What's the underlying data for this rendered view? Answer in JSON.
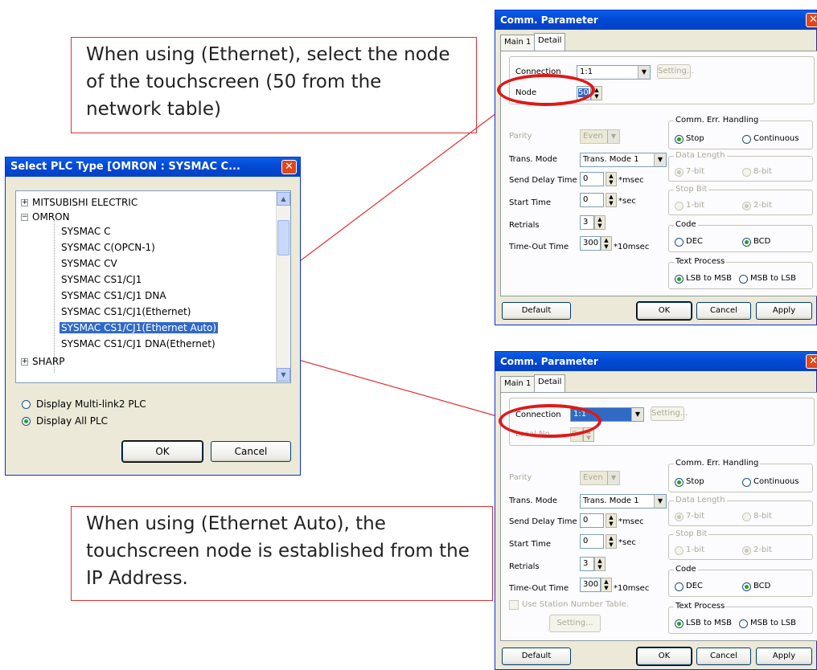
{
  "callouts": {
    "ethernet": "When using (Ethernet), select the node of the touchscreen (50 from the network table)",
    "ethernet_auto": "When using (Ethernet Auto), the touchscreen node is established from the IP Address."
  },
  "plc_dialog": {
    "title": "Select PLC Type [OMRON : SYSMAC C...",
    "tree": [
      {
        "label": "MITSUBISHI ELECTRIC",
        "expander": "+"
      },
      {
        "label": "OMRON",
        "expander": "-"
      },
      {
        "label": "SYSMAC C"
      },
      {
        "label": "SYSMAC C(OPCN-1)"
      },
      {
        "label": "SYSMAC CV"
      },
      {
        "label": "SYSMAC CS1/CJ1"
      },
      {
        "label": "SYSMAC CS1/CJ1 DNA"
      },
      {
        "label": "SYSMAC CS1/CJ1(Ethernet)"
      },
      {
        "label": "SYSMAC CS1/CJ1(Ethernet Auto)",
        "selected": true
      },
      {
        "label": "SYSMAC CS1/CJ1 DNA(Ethernet)"
      },
      {
        "label": "SHARP",
        "expander": "+"
      }
    ],
    "radio_multilink": "Display Multi-link2 PLC",
    "radio_all": "Display All PLC",
    "ok": "OK",
    "cancel": "Cancel"
  },
  "comm1": {
    "title": "Comm. Parameter",
    "tab_main": "Main 1",
    "tab_detail": "Detail",
    "connection_label": "Connection",
    "connection_value": "1:1",
    "setting": "Setting...",
    "node_label": "Node",
    "node_value": "50",
    "parity_label": "Parity",
    "parity_value": "Even",
    "trans_mode_label": "Trans. Mode",
    "trans_mode_value": "Trans. Mode 1",
    "send_delay_label": "Send Delay Time",
    "send_delay_value": "0",
    "send_delay_unit": "*msec",
    "start_time_label": "Start Time",
    "start_time_value": "0",
    "start_time_unit": "*sec",
    "retrials_label": "Retrials",
    "retrials_value": "3",
    "timeout_label": "Time-Out Time",
    "timeout_value": "300",
    "timeout_unit": "*10msec",
    "err_group": "Comm. Err. Handling",
    "err_stop": "Stop",
    "err_cont": "Continuous",
    "datalen_group": "Data Length",
    "datalen_7": "7-bit",
    "datalen_8": "8-bit",
    "stopbit_group": "Stop Bit",
    "stopbit_1": "1-bit",
    "stopbit_2": "2-bit",
    "code_group": "Code",
    "code_dec": "DEC",
    "code_bcd": "BCD",
    "text_group": "Text Process",
    "text_lsb": "LSB to MSB",
    "text_msb": "MSB to LSB",
    "default": "Default",
    "ok": "OK",
    "cancel": "Cancel",
    "apply": "Apply"
  },
  "comm2": {
    "title": "Comm. Parameter",
    "tab_main": "Main 1",
    "tab_detail": "Detail",
    "connection_label": "Connection",
    "connection_value": "1:1",
    "setting": "Setting...",
    "local_label": "Local No.",
    "local_value": "0",
    "parity_label": "Parity",
    "parity_value": "Even",
    "trans_mode_label": "Trans. Mode",
    "trans_mode_value": "Trans. Mode 1",
    "send_delay_label": "Send Delay Time",
    "send_delay_value": "0",
    "send_delay_unit": "*msec",
    "start_time_label": "Start Time",
    "start_time_value": "0",
    "start_time_unit": "*sec",
    "retrials_label": "Retrials",
    "retrials_value": "3",
    "timeout_label": "Time-Out Time",
    "timeout_value": "300",
    "timeout_unit": "*10msec",
    "use_station": "Use Station Number Table.",
    "station_setting": "Setting...",
    "err_group": "Comm. Err. Handling",
    "err_stop": "Stop",
    "err_cont": "Continuous",
    "datalen_group": "Data Length",
    "datalen_7": "7-bit",
    "datalen_8": "8-bit",
    "stopbit_group": "Stop Bit",
    "stopbit_1": "1-bit",
    "stopbit_2": "2-bit",
    "code_group": "Code",
    "code_dec": "DEC",
    "code_bcd": "BCD",
    "text_group": "Text Process",
    "text_lsb": "LSB to MSB",
    "text_msb": "MSB to LSB",
    "default": "Default",
    "ok": "OK",
    "cancel": "Cancel",
    "apply": "Apply"
  },
  "colors": {
    "callout_border": "#e03030",
    "xp_title": "#0349d4",
    "selection": "#316ac5"
  }
}
